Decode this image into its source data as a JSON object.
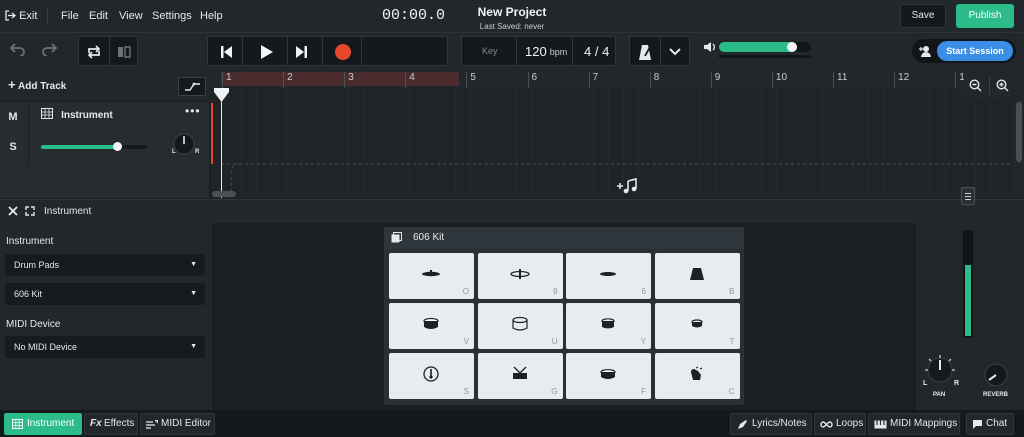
{
  "menu": {
    "exit": "Exit",
    "file": "File",
    "edit": "Edit",
    "view": "View",
    "settings": "Settings",
    "help": "Help"
  },
  "project": {
    "title": "New Project",
    "last_saved": "Last Saved: never"
  },
  "actions": {
    "save": "Save",
    "publish": "Publish",
    "start_session": "Start Session"
  },
  "transport": {
    "time": "00:00.0",
    "key_label": "Key",
    "bpm_value": "120",
    "bpm_unit": "bpm",
    "time_signature": "4 / 4",
    "master_volume": 0.85
  },
  "timeline": {
    "add_track": "Add Track",
    "bars": [
      "1",
      "2",
      "3",
      "4",
      "5",
      "6",
      "7",
      "8",
      "9",
      "10",
      "11",
      "12",
      "1"
    ]
  },
  "track": {
    "mute": "M",
    "solo": "S",
    "name": "Instrument",
    "volume": 0.72
  },
  "instrument_panel": {
    "title": "Instrument",
    "instrument_label": "Instrument",
    "instrument_type": "Drum Pads",
    "kit": "606 Kit",
    "midi_device_label": "MIDI Device",
    "midi_device": "No MIDI Device"
  },
  "kit_panel": {
    "title": "606 Kit",
    "pads": [
      {
        "key": "O",
        "icon": "cymbal-icon"
      },
      {
        "key": "9",
        "icon": "ride-cymbal-icon"
      },
      {
        "key": "6",
        "icon": "hihat-icon"
      },
      {
        "key": "B",
        "icon": "cowbell-icon"
      },
      {
        "key": "V",
        "icon": "tom-icon"
      },
      {
        "key": "U",
        "icon": "floor-tom-icon"
      },
      {
        "key": "Y",
        "icon": "mid-tom-icon"
      },
      {
        "key": "T",
        "icon": "high-tom-icon"
      },
      {
        "key": "S",
        "icon": "kick-drum-icon"
      },
      {
        "key": "G",
        "icon": "snare-drum-icon"
      },
      {
        "key": "F",
        "icon": "rim-drum-icon"
      },
      {
        "key": "C",
        "icon": "hand-clap-icon"
      }
    ]
  },
  "mixer": {
    "pan_label": "PAN",
    "reverb_label": "REVERB",
    "pan_l": "L",
    "pan_r": "R",
    "level": 0.68
  },
  "footer": {
    "instrument": "Instrument",
    "effects": "Effects",
    "fx_prefix": "Fx",
    "midi_editor": "MIDI Editor",
    "lyrics": "Lyrics/Notes",
    "loops": "Loops",
    "midi_mappings": "MIDI Mappings",
    "chat": "Chat"
  },
  "colors": {
    "accent": "#2bbc8a",
    "session": "#3a8ee8",
    "record": "#e8452c"
  }
}
